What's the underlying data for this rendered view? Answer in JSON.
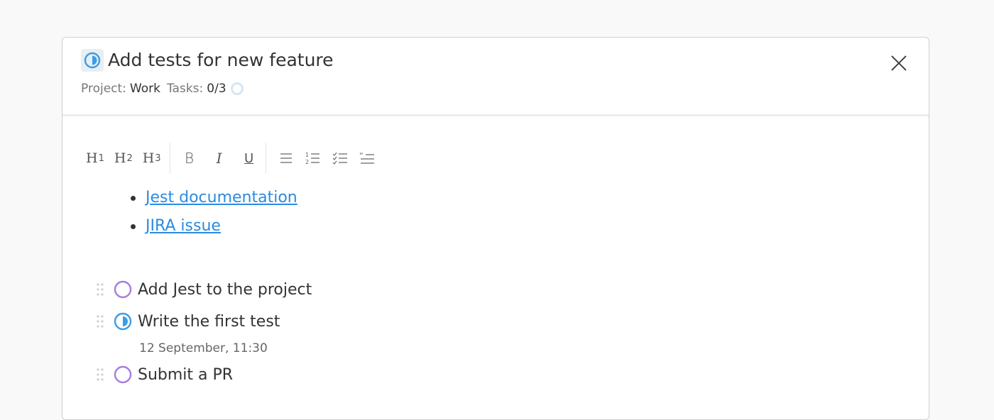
{
  "task": {
    "title": "Add tests for new feature",
    "status_icon": "in-progress-icon",
    "project_label": "Project:",
    "project_value": "Work",
    "tasks_label": "Tasks:",
    "tasks_value": "0/3",
    "tasks_progress": 0
  },
  "toolbar": {
    "h1": "H",
    "h1_sub": "1",
    "h2": "H",
    "h2_sub": "2",
    "h3": "H",
    "h3_sub": "3",
    "bold": "B",
    "italic": "I",
    "underline": "U",
    "icons": [
      "bullet-list-icon",
      "numbered-list-icon",
      "checklist-icon",
      "blockquote-icon"
    ]
  },
  "links": [
    {
      "label": "Jest documentation"
    },
    {
      "label": "JIRA issue"
    }
  ],
  "subtasks": [
    {
      "label": "Add Jest to the project",
      "status": "todo"
    },
    {
      "label": "Write the first test",
      "status": "in-progress",
      "date": "12 September, 11:30"
    },
    {
      "label": "Submit a PR",
      "status": "todo"
    }
  ],
  "colors": {
    "accent_blue": "#3a9de6",
    "todo_purple": "#a57de0",
    "link": "#2b8be0"
  }
}
